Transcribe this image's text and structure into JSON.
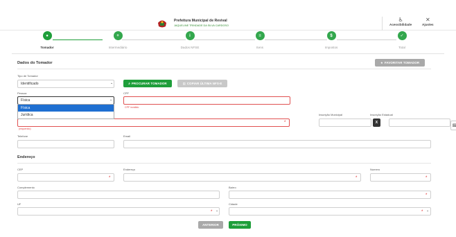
{
  "header": {
    "org_name": "Prefeitura Municipal de Revival",
    "user_name": "JAQUELINE TRINDADE DA SILVA CARDOSO",
    "accessibility_label": "Acessibilidade",
    "settings_label": "Ajustes",
    "accessibility_icon": "♿",
    "settings_icon": "✕"
  },
  "stepper": {
    "steps": [
      {
        "label": "Tomador",
        "icon": "person-icon",
        "glyph": "●",
        "state": "active"
      },
      {
        "label": "Intermediário",
        "icon": "add-user-icon",
        "glyph": "+",
        "state": "pending"
      },
      {
        "label": "Dados NFSE",
        "icon": "info-icon",
        "glyph": "i",
        "state": "pending"
      },
      {
        "label": "Itens",
        "icon": "list-icon",
        "glyph": "≡",
        "state": "pending"
      },
      {
        "label": "Impostos",
        "icon": "money-icon",
        "glyph": "$",
        "state": "pending"
      },
      {
        "label": "Total",
        "icon": "check-icon",
        "glyph": "✓",
        "state": "pending"
      }
    ]
  },
  "tomador": {
    "title": "Dados do Tomador",
    "favorite_button": "FAVORITAR TOMADOR",
    "tipo_label": "Tipo de Tomador",
    "tipo_value": "Identificado",
    "procurar_button": "PROCURAR TOMADOR",
    "copiar_button": "COPIAR ÚLTIMA NFS-E",
    "pessoa_label": "Pessoa",
    "pessoa_value": "Física",
    "pessoa_options": [
      "Física",
      "Jurídica"
    ],
    "cpf_label": "CPF",
    "cpf_error": "CPF inválido",
    "nome_error": "(requerido)",
    "im_label": "Inscrição Municipal",
    "ie_label": "Inscrição Estadual",
    "clear_button": "X",
    "telefone_label": "Telefone",
    "email_label": "Email"
  },
  "endereco": {
    "title": "Endereço",
    "cep_label": "CEP",
    "endereco_label": "Endereço",
    "numero_label": "Numero",
    "complemento_label": "Complemento",
    "bairro_label": "Bairro",
    "uf_label": "UF",
    "cidade_label": "Cidade"
  },
  "footer": {
    "anterior_button": "ANTERIOR",
    "proximo_button": "PRÓXIMO"
  },
  "colors": {
    "primary_green": "#1e9e3a",
    "error_red": "#e05050",
    "selected_blue": "#1f6fd1"
  }
}
